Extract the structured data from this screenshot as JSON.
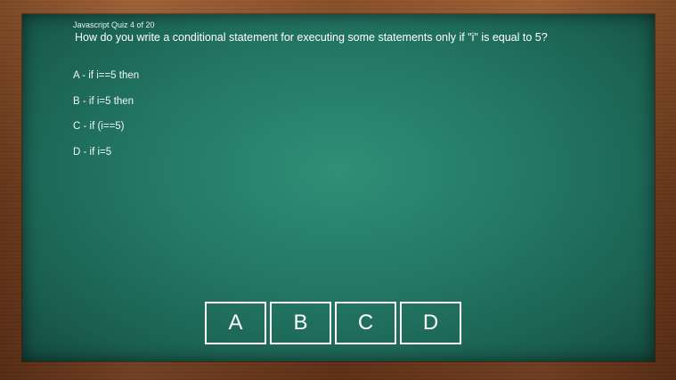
{
  "quiz": {
    "title": "Javascript Quiz 4 of 20",
    "question": "How do you write a conditional statement for executing some statements only if \"i\" is equal to 5?",
    "options": [
      {
        "text": "A - if i==5 then"
      },
      {
        "text": "B - if i=5 then"
      },
      {
        "text": "C - if (i==5)"
      },
      {
        "text": "D - if i=5"
      }
    ]
  },
  "answers": {
    "buttons": [
      {
        "label": "A"
      },
      {
        "label": "B"
      },
      {
        "label": "C"
      },
      {
        "label": "D"
      }
    ]
  },
  "colors": {
    "chalkboard": "#237765",
    "frame_wood": "#7c4320",
    "chalk_text": "#ffffff"
  }
}
